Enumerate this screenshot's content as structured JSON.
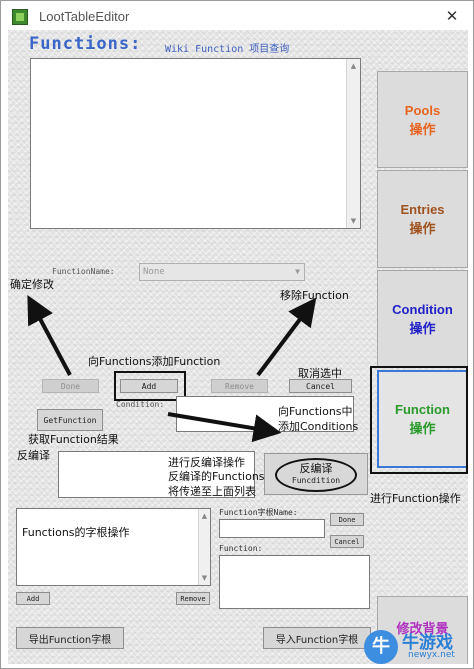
{
  "window": {
    "title": "LootTableEditor",
    "close_glyph": "✕"
  },
  "header": {
    "title": "Functions:",
    "wiki_link": "Wiki Function 项目查询"
  },
  "function_name": {
    "label": "FunctionName:",
    "value": "None"
  },
  "buttons": {
    "done": "Done",
    "add": "Add",
    "remove": "Remove",
    "cancel": "Cancel",
    "get_function": "GetFunction",
    "decompile_line1": "反编译",
    "decompile_line2": "Funcdition",
    "root_done": "Done",
    "root_cancel": "Cancel",
    "root_add": "Add",
    "root_remove": "Remove",
    "export": "导出Function字根",
    "import": "导入Function字根"
  },
  "labels": {
    "condition": "Condition:",
    "root_name": "Function字根Name:",
    "function": "Function:"
  },
  "sidebar": {
    "items": [
      {
        "line1": "Pools",
        "line2": "操作",
        "color": "#e8641e"
      },
      {
        "line1": "Entries",
        "line2": "操作",
        "color": "#a0521e"
      },
      {
        "line1": "Condition",
        "line2": "操作",
        "color": "#2020c8"
      },
      {
        "line1": "Function",
        "line2": "操作",
        "color": "#2a9a2a"
      },
      {
        "line1": "修改背景",
        "line2": "",
        "color": "#b030c0"
      }
    ]
  },
  "annotations": {
    "confirm_edit": "确定修改",
    "remove_function": "移除Function",
    "add_function": "向Functions添加Function",
    "cancel_select": "取消选中",
    "add_conditions_line1": "向Functions中",
    "add_conditions_line2": "添加Conditions",
    "get_function_result": "获取Function结果",
    "decompile": "反编译",
    "decompile_desc_line1": "进行反编译操作",
    "decompile_desc_line2": "反编译的Functions",
    "decompile_desc_line3": "将传递至上面列表",
    "function_op": "进行Function操作",
    "root_op": "Functions的字根操作"
  },
  "watermark": {
    "text1": "牛游戏",
    "text2": "newyx.net",
    "logo": "牛"
  },
  "colors": {
    "highlight_border": "#111111",
    "arrow": "#111111",
    "selected_border": "#3c78d8"
  }
}
